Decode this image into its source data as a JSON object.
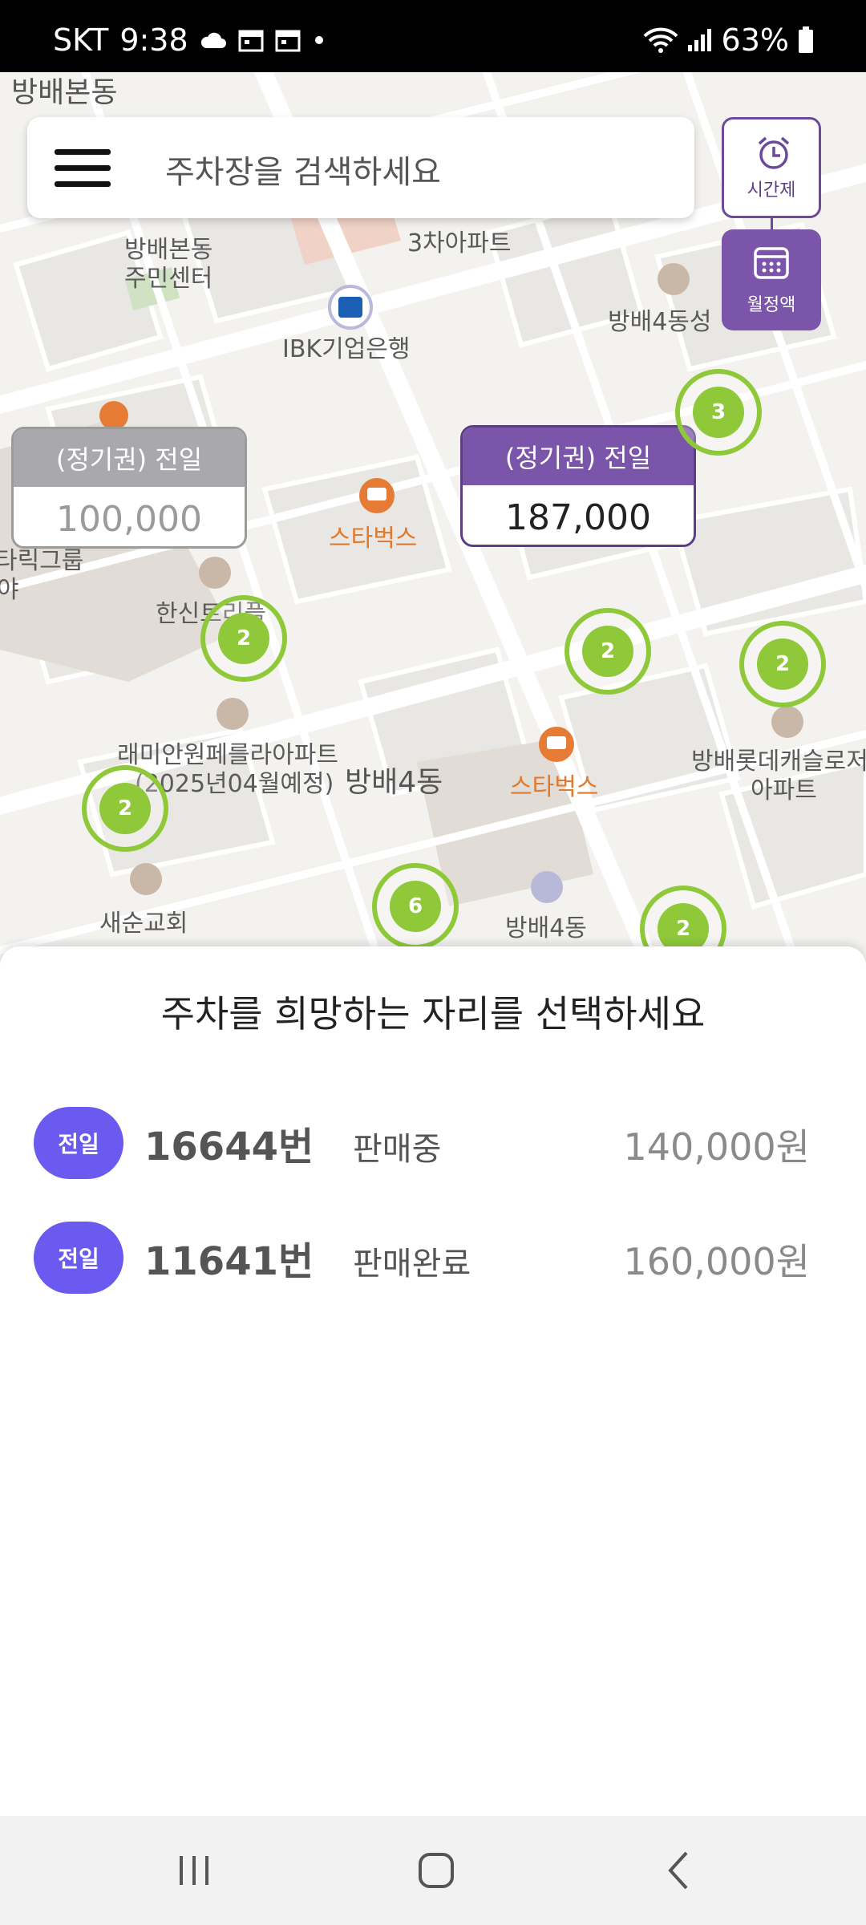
{
  "status_bar": {
    "carrier": "SKT",
    "time": "9:38",
    "battery": "63%",
    "icons": [
      "cloud-icon",
      "calendar-icon",
      "calendar-icon",
      "dot-icon",
      "wifi-icon",
      "signal-icon",
      "battery-icon"
    ]
  },
  "search": {
    "placeholder": "주차장을 검색하세요"
  },
  "side_buttons": {
    "time_label": "시간제",
    "monthly_label": "월정액"
  },
  "map": {
    "labels": {
      "area_top": "방배본동",
      "community_center_1": "방배본동",
      "community_center_2": "주민센터",
      "apartment_3": "3차아파트",
      "bank": "IBK기업은행",
      "church_right": "방배4동성",
      "starbucks_1": "스타벅스",
      "starbucks_2": "스타벅스",
      "shinsin": "한신트리플",
      "raemian_1": "래미안원페를라아파트",
      "raemian_2": "(2025년04월예정)",
      "district": "방배4동",
      "lotte_1": "방배롯데캐슬로저",
      "lotte_2": "아파트",
      "church": "새순교회",
      "office_4dong": "방배4동",
      "left_group": "타릭그룹",
      "left_edge": "야"
    },
    "price_tags": [
      {
        "header": "(정기권) 전일",
        "value": "100,000",
        "style": "gray"
      },
      {
        "header": "(정기권) 전일",
        "value": "187,000",
        "style": "purple"
      }
    ],
    "clusters": [
      "3",
      "2",
      "2",
      "2",
      "2",
      "6",
      "2"
    ]
  },
  "sheet": {
    "title": "주차를 희망하는 자리를 선택하세요",
    "spots": [
      {
        "badge": "전일",
        "number": "16644번",
        "status": "판매중",
        "price": "140,000원"
      },
      {
        "badge": "전일",
        "number": "11641번",
        "status": "판매완료",
        "price": "160,000원"
      }
    ]
  },
  "colors": {
    "accent_purple": "#7a55a9",
    "badge_blue": "#6a5af0",
    "cluster_green": "#8fc93a"
  }
}
